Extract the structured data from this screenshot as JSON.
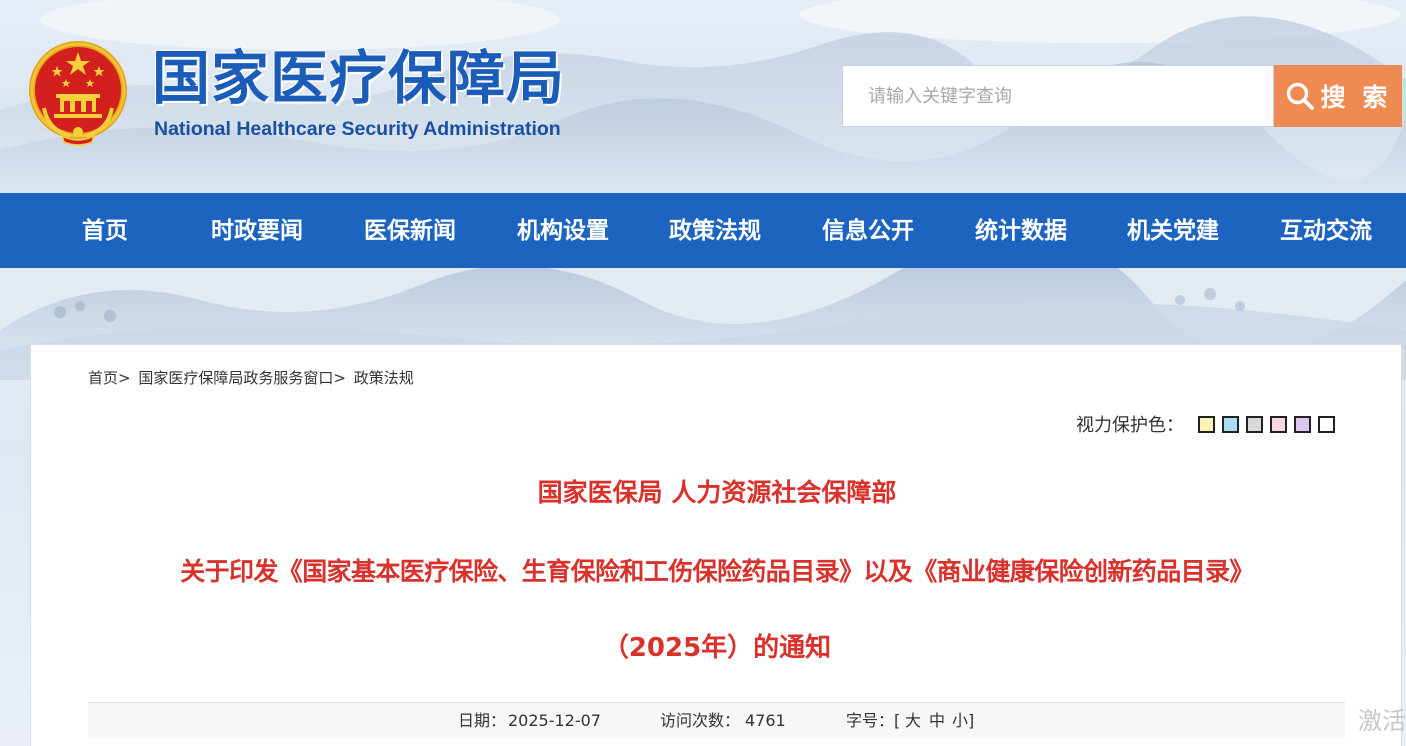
{
  "site": {
    "title_cn": "国家医疗保障局",
    "title_en": "National Healthcare Security Administration"
  },
  "search": {
    "placeholder": "请输入关键字查询",
    "button_label": "搜 索"
  },
  "nav": [
    {
      "label": "首页"
    },
    {
      "label": "时政要闻"
    },
    {
      "label": "医保新闻"
    },
    {
      "label": "机构设置"
    },
    {
      "label": "政策法规"
    },
    {
      "label": "信息公开"
    },
    {
      "label": "统计数据"
    },
    {
      "label": "机关党建"
    },
    {
      "label": "互动交流"
    }
  ],
  "breadcrumb": [
    {
      "label": "首页"
    },
    {
      "label": "国家医疗保障局政务服务窗口"
    },
    {
      "label": "政策法规"
    }
  ],
  "breadcrumb_sep": ">",
  "eye_care": {
    "label": "视力保护色：",
    "colors": [
      "#fbf3b6",
      "#a9dcf5",
      "#d9d9d9",
      "#f8d5e1",
      "#ddc7f1",
      "#ffffff"
    ]
  },
  "article": {
    "headline_line1": "国家医保局 人力资源社会保障部",
    "headline_line2": "关于印发《国家基本医疗保险、生育保险和工伤保险药品目录》以及《商业健康保险创新药品目录》",
    "headline_line3": "（2025年）的通知",
    "date_label": "日期：",
    "date": "2025-12-07",
    "visits_label": "访问次数：",
    "visits": "4761",
    "font_size_label": "字号：",
    "font_size_open": "[",
    "font_large": "大",
    "font_medium": "中",
    "font_small": "小",
    "font_size_close": "]"
  },
  "watermark": {
    "text": "激活"
  },
  "colors": {
    "nav_bg": "#1c64c0",
    "title_blue": "#1a5cb8",
    "search_btn": "#ee8a52",
    "headline_red": "#d9322c"
  }
}
